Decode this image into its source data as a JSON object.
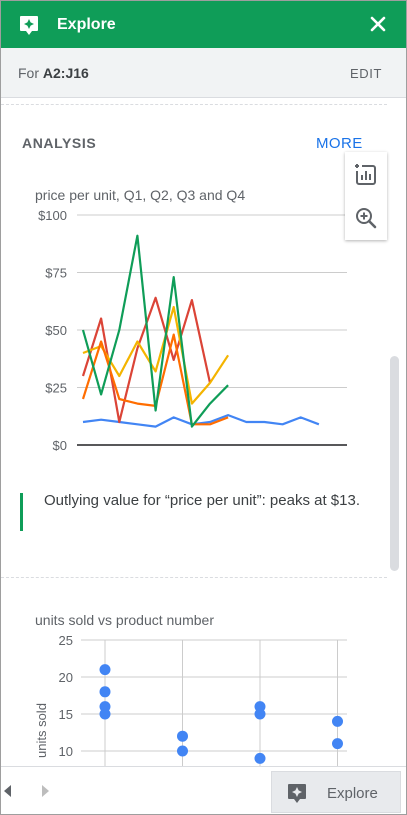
{
  "header": {
    "title": "Explore",
    "close_icon": "close-icon",
    "logo_icon": "explore-icon"
  },
  "range": {
    "prefix": "For ",
    "value": "A2:J16",
    "edit_label": "EDIT"
  },
  "analysis": {
    "section_title": "ANALYSIS",
    "more_label": "MORE"
  },
  "tools": {
    "insert_chart": "insert-chart-icon",
    "zoom": "zoom-in-icon"
  },
  "insight": {
    "text": "Outlying value for “price per unit”: peaks at $13."
  },
  "colors": {
    "brand": "#0f9d58",
    "link": "#1a73e8",
    "blue": "#4285f4",
    "red": "#db4437",
    "yellow": "#f4b400",
    "orange": "#ff6d00",
    "green": "#0f9d58"
  },
  "footer": {
    "explore_label": "Explore"
  },
  "chart_data": [
    {
      "type": "line",
      "title": "price per unit, Q1, Q2, Q3 and Q4",
      "ylim": [
        0,
        100
      ],
      "yticks": [
        "$0",
        "$25",
        "$50",
        "$75",
        "$100"
      ],
      "x": [
        1,
        2,
        3,
        4,
        5,
        6,
        7,
        8,
        9,
        10,
        11,
        12,
        13,
        14,
        15
      ],
      "series": [
        {
          "color": "#4285f4",
          "values": [
            10,
            11,
            10,
            9,
            8,
            12,
            9,
            10,
            13,
            10,
            10,
            9,
            12,
            9,
            null
          ]
        },
        {
          "color": "#db4437",
          "values": [
            30,
            55,
            10,
            42,
            64,
            37,
            63,
            27,
            null,
            null,
            null,
            null,
            null,
            null,
            null
          ]
        },
        {
          "color": "#f4b400",
          "values": [
            40,
            43,
            30,
            45,
            32,
            60,
            18,
            27,
            39,
            null,
            null,
            null,
            null,
            null,
            null
          ]
        },
        {
          "color": "#ff6d00",
          "values": [
            20,
            45,
            20,
            18,
            17,
            48,
            9,
            9,
            12,
            null,
            null,
            null,
            null,
            null,
            null
          ]
        },
        {
          "color": "#0f9d58",
          "values": [
            50,
            22,
            50,
            91,
            15,
            73,
            8,
            18,
            26,
            null,
            null,
            null,
            null,
            null,
            null
          ]
        }
      ]
    },
    {
      "type": "scatter",
      "title": "units sold vs product number",
      "ylabel": "units sold",
      "ylim": [
        10,
        25
      ],
      "yticks": [
        10,
        15,
        20,
        25
      ],
      "color": "#4285f4",
      "groups": [
        {
          "x": 1,
          "y": [
            21,
            18,
            16,
            15
          ]
        },
        {
          "x": 2,
          "y": [
            12,
            10
          ]
        },
        {
          "x": 3,
          "y": [
            16,
            15,
            9
          ]
        },
        {
          "x": 4,
          "y": [
            14,
            11
          ]
        }
      ]
    }
  ]
}
